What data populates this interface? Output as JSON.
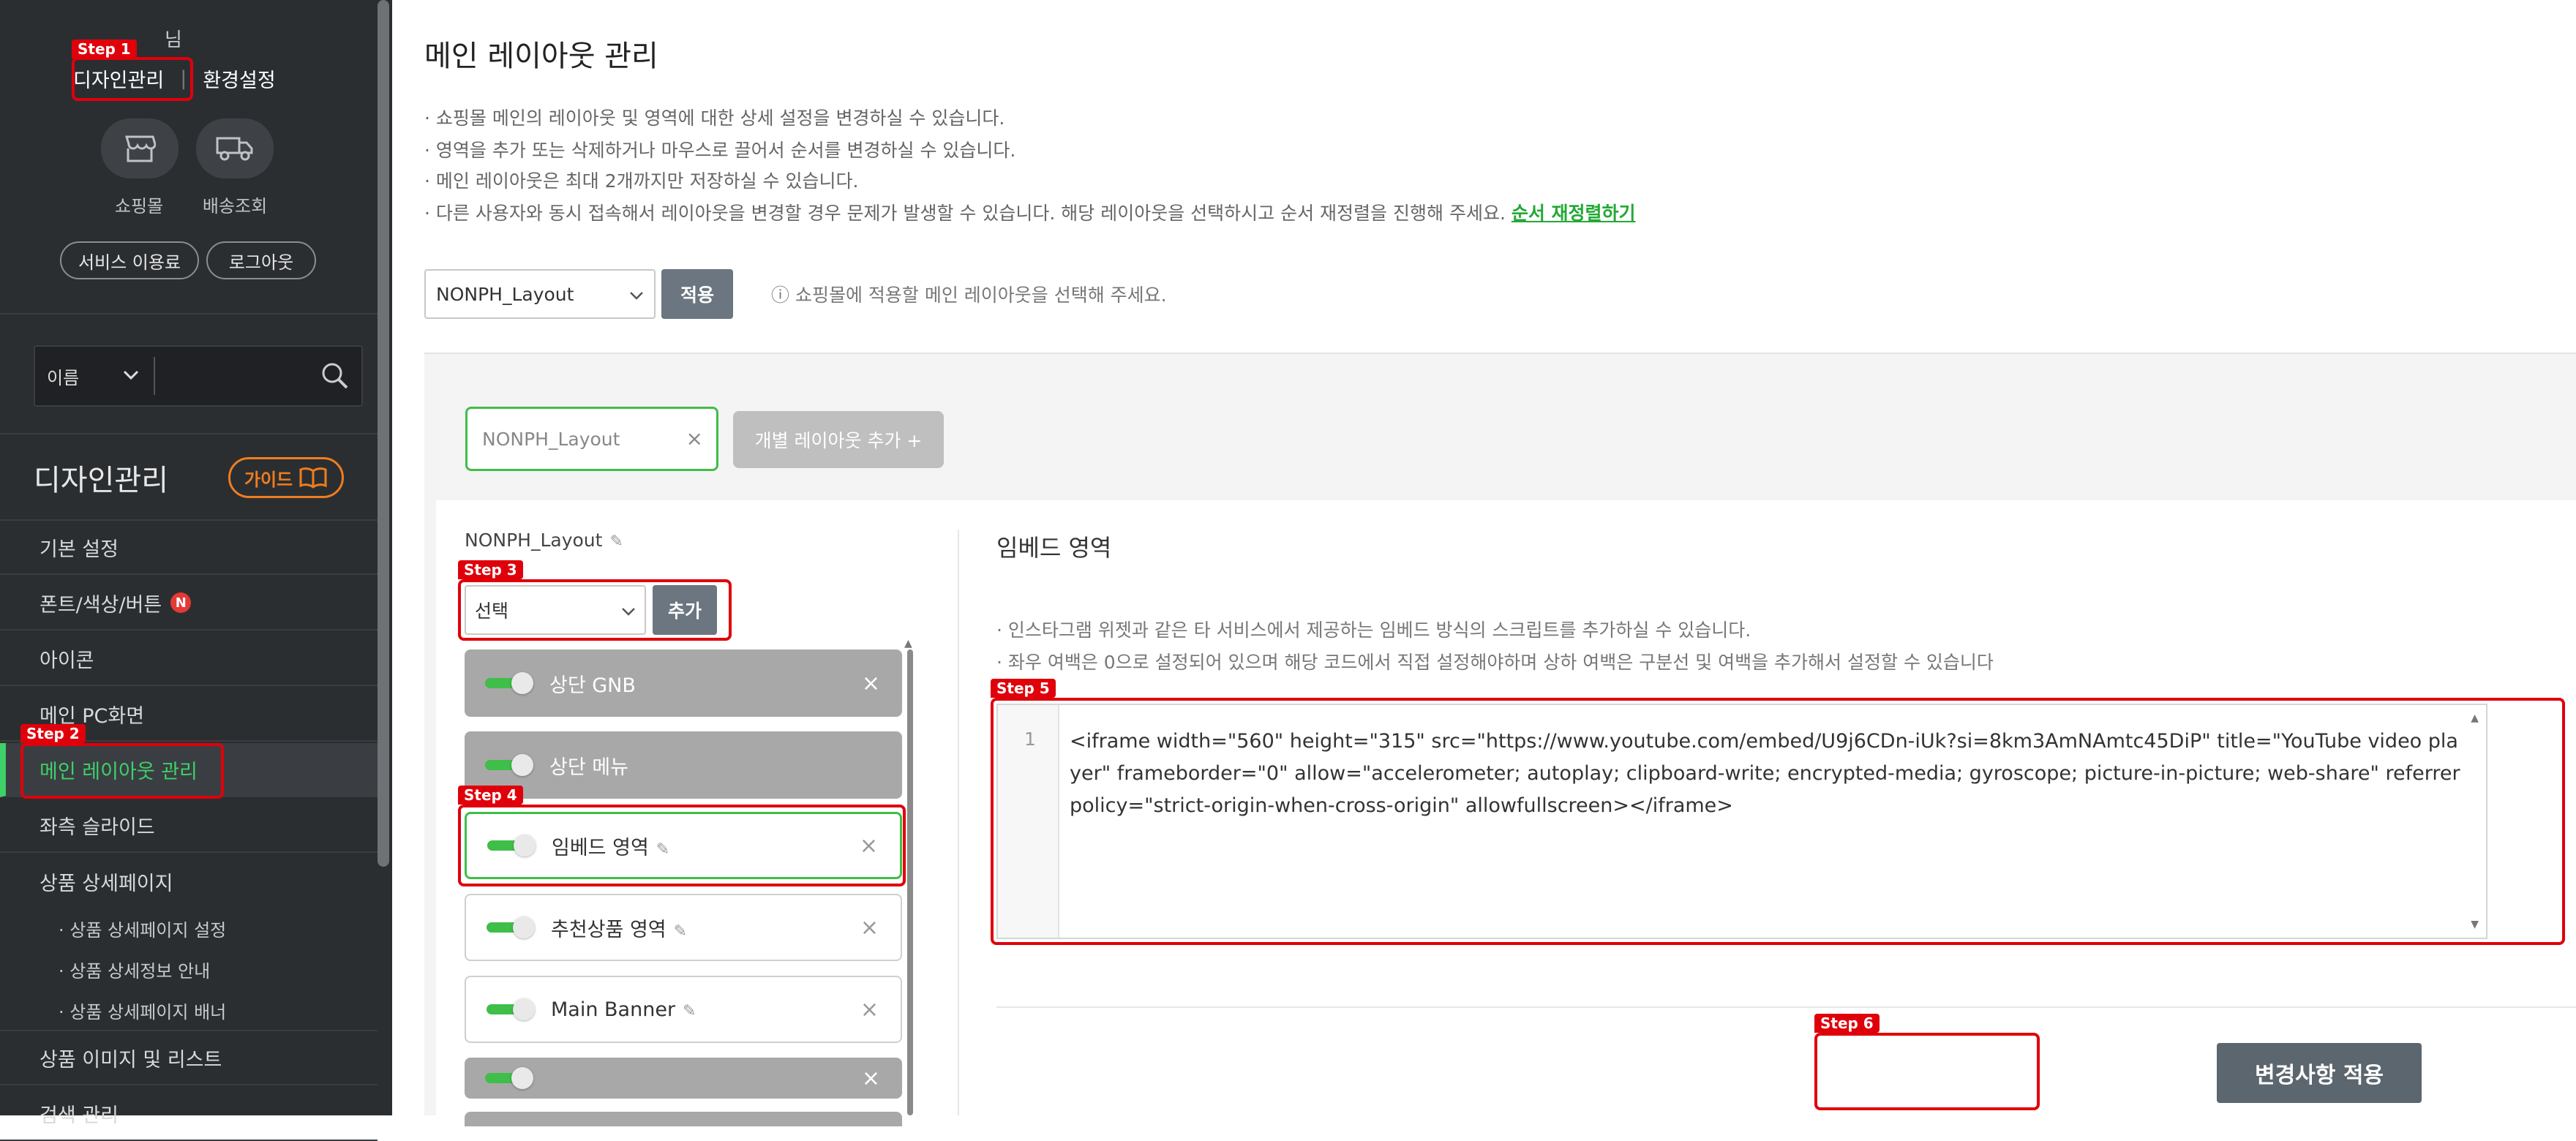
{
  "sidebar": {
    "user_name": "님",
    "link_design": "디자인관리",
    "link_settings": "환경설정",
    "shop_label": "쇼핑몰",
    "delivery_label": "배송조회",
    "service_btn": "서비스 이용료",
    "logout_btn": "로그아웃",
    "search_select": "이름",
    "section_title": "디자인관리",
    "guide_btn": "가이드",
    "menu": [
      {
        "label": "기본 설정"
      },
      {
        "label": "폰트/색상/버튼",
        "badge": "N"
      },
      {
        "label": "아이콘"
      },
      {
        "label": "메인 PC화면"
      },
      {
        "label": "메인 레이아웃 관리",
        "active": true
      },
      {
        "label": "좌측 슬라이드"
      },
      {
        "label": "상품 상세페이지"
      }
    ],
    "submenu": [
      "· 상품 상세페이지 설정",
      "· 상품 상세정보 안내",
      "· 상품 상세페이지 배너"
    ],
    "menu_after": [
      "상품 이미지 및 리스트",
      "검색 관리"
    ]
  },
  "main": {
    "title": "메인 레이아웃 관리",
    "descriptions": [
      "· 쇼핑몰 메인의 레이아웃 및 영역에 대한 상세 설정을 변경하실 수 있습니다.",
      "· 영역을 추가 또는 삭제하거나 마우스로 끌어서 순서를 변경하실 수 있습니다.",
      "· 메인 레이아웃은 최대 2개까지만 저장하실 수 있습니다.",
      "· 다른 사용자와 동시 접속해서 레이아웃을 변경할 경우 문제가 발생할 수 있습니다. 해당 레이아웃을 선택하시고 순서 재정렬을 진행해 주세요."
    ],
    "reorder_link": "순서 재정렬하기",
    "layout_select": "NONPH_Layout",
    "apply_btn": "적용",
    "hint": "ⓘ 쇼핑몰에 적용할 메인 레이아웃을 선택해 주세요.",
    "tab_layout": "NONPH_Layout",
    "tab_add": "개별 레이아웃 추가 +",
    "layout_name": "NONPH_Layout",
    "area_select": "선택",
    "area_add_btn": "추가",
    "items": [
      {
        "label": "상단 GNB",
        "style": "gray"
      },
      {
        "label": "상단 메뉴",
        "style": "gray"
      },
      {
        "label": "임베드 영역",
        "style": "sel"
      },
      {
        "label": "추천상품 영역",
        "style": "white"
      },
      {
        "label": "Main Banner",
        "style": "white"
      },
      {
        "label": "",
        "style": "gray"
      }
    ],
    "section_title": "임베드 영역",
    "section_desc": [
      "· 인스타그램 위젯과 같은 타 서비스에서 제공하는 임베드 방식의 스크립트를 추가하실 수 있습니다.",
      "· 좌우 여백은 0으로 설정되어 있으며 해당 코드에서 직접 설정해야하며 상하 여백은 구분선 및 여백을 추가해서 설정할 수 있습니다"
    ],
    "line_number": "1",
    "code": "<iframe width=\"560\" height=\"315\" src=\"https://www.youtube.com/embed/U9j6CDn-iUk?si=8km3AmNAmtc45DiP\" title=\"YouTube video player\" frameborder=\"0\" allow=\"accelerometer; autoplay; clipboard-write; encrypted-media; gyroscope; picture-in-picture; web-share\" referrerpolicy=\"strict-origin-when-cross-origin\" allowfullscreen></iframe>",
    "save_btn": "변경사항 적용"
  },
  "steps": [
    "Step 1",
    "Step 2",
    "Step 3",
    "Step 4",
    "Step 5",
    "Step 6"
  ],
  "colors": {
    "accent_green": "#3fbe49",
    "step_red": "#e0000b",
    "sidebar_bg": "#2b2e31",
    "guide_orange": "#f07d1e"
  }
}
